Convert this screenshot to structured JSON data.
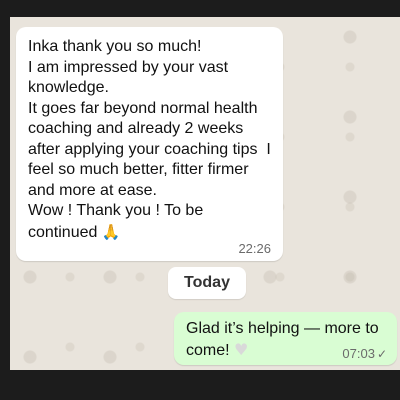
{
  "incoming_message": {
    "text": "Inka thank you so much!\nI am impressed by your vast knowledge.\nIt goes far beyond normal health coaching and already 2 weeks after applying your coaching tips  I feel so much better, fitter firmer and more at ease.\nWow ! Thank you ! To be continued ",
    "emoji": "🙏",
    "time": "22:26"
  },
  "date_separator": {
    "label": "Today"
  },
  "outgoing_message": {
    "text": "Glad it’s helping — more to come! ",
    "emoji": "♥",
    "time": "07:03",
    "status_icon": "✓"
  },
  "colors": {
    "chat_background": "#e9e4dc",
    "incoming_bubble": "#ffffff",
    "outgoing_bubble": "#d9fdd3",
    "timestamp": "#6b6b6b"
  }
}
